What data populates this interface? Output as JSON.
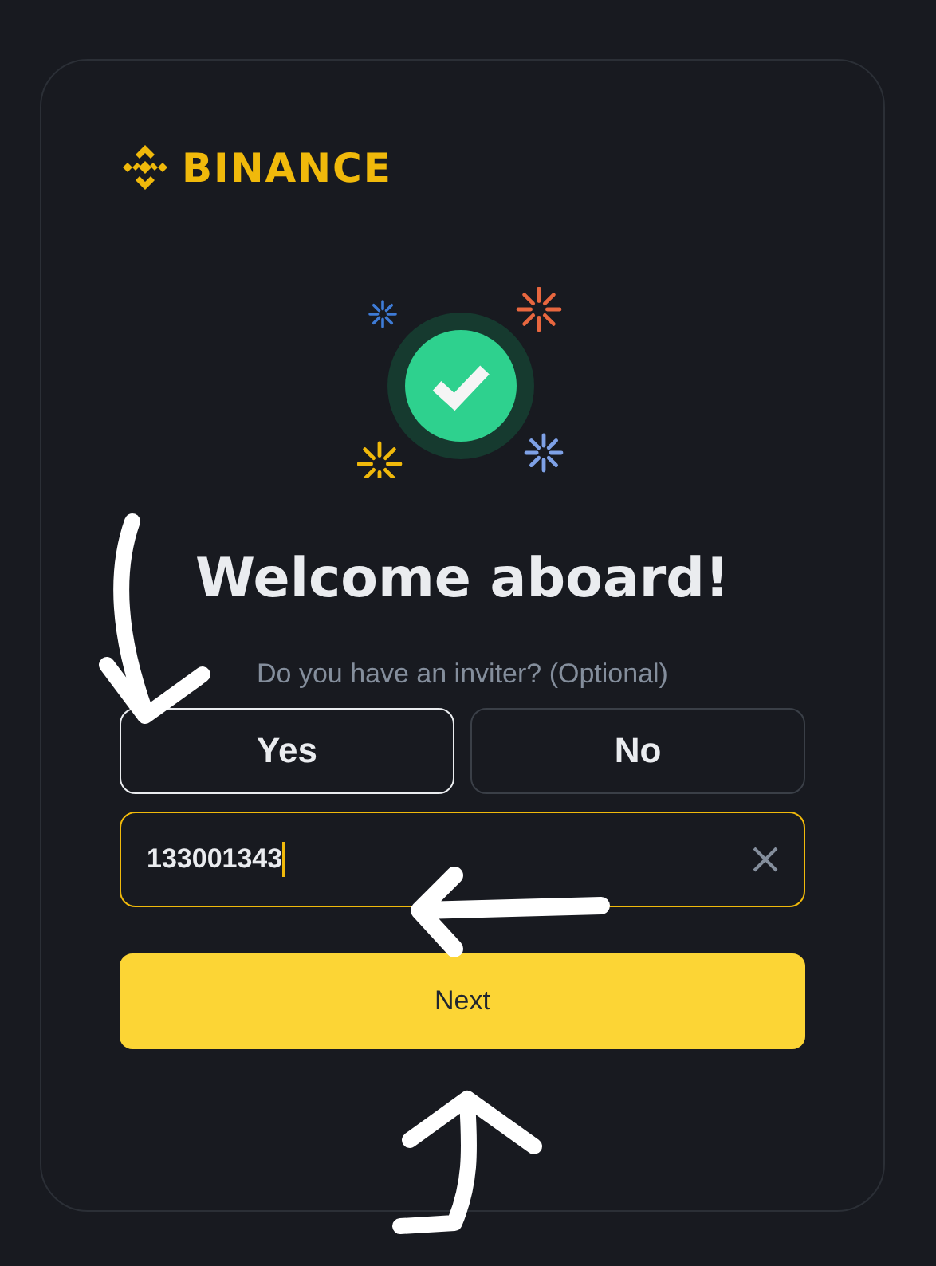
{
  "brand": {
    "name": "BINANCE"
  },
  "heading": "Welcome aboard!",
  "question": "Do you have an inviter? (Optional)",
  "options": [
    {
      "label": "Yes",
      "selected": true
    },
    {
      "label": "No",
      "selected": false
    }
  ],
  "inviter_field": {
    "value": "133001343",
    "focused": true
  },
  "next_button": {
    "label": "Next"
  }
}
